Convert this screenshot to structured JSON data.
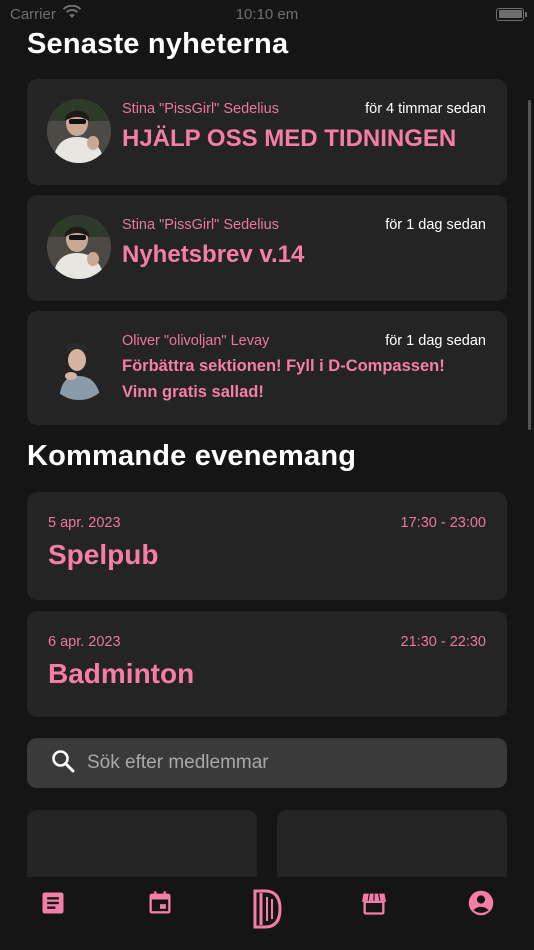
{
  "status_bar": {
    "carrier": "Carrier",
    "time": "10:10 em"
  },
  "news": {
    "heading": "Senaste nyheterna",
    "items": [
      {
        "author": "Stina \"PissGirl\" Sedelius",
        "time": "för 4 timmar sedan",
        "title": "HJÄLP OSS MED TIDNINGEN"
      },
      {
        "author": "Stina \"PissGirl\" Sedelius",
        "time": "för 1 dag sedan",
        "title": "Nyhetsbrev v.14"
      },
      {
        "author": "Oliver \"olivoljan\" Levay",
        "time": "för 1 dag sedan",
        "title": "Förbättra sektionen! Fyll i D-Compassen! Vinn gratis sallad!"
      }
    ]
  },
  "events": {
    "heading": "Kommande evenemang",
    "items": [
      {
        "date": "5 apr. 2023",
        "time": "17:30 - 23:00",
        "name": "Spelpub"
      },
      {
        "date": "6 apr. 2023",
        "time": "21:30 - 22:30",
        "name": "Badminton"
      }
    ]
  },
  "search": {
    "placeholder": "Sök efter medlemmar",
    "value": ""
  },
  "tab_bar": {
    "tabs": [
      {
        "icon": "article-icon"
      },
      {
        "icon": "calendar-icon"
      },
      {
        "icon": "d-logo-icon"
      },
      {
        "icon": "store-icon"
      },
      {
        "icon": "account-icon"
      }
    ]
  },
  "colors": {
    "accent": "#f47ea8",
    "background": "#151515",
    "card": "#242424",
    "search": "#3a3a3a"
  }
}
